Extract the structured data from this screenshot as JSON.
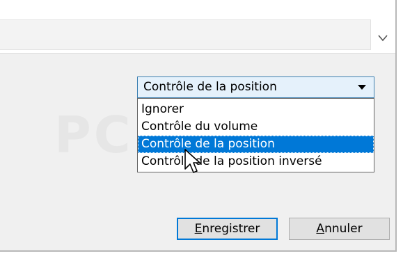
{
  "mode_select": {
    "selected": "Contrôle de la position",
    "options": [
      "Ignorer",
      "Contrôle du volume",
      "Contrôle de la position",
      "Contrôle de la position inversé"
    ],
    "selected_index": 2
  },
  "buttons": {
    "save": {
      "mnemonic": "E",
      "rest": "nregistrer"
    },
    "cancel": {
      "mnemonic": "A",
      "rest": "nnuler"
    }
  },
  "watermark_text": "PC",
  "icons": {
    "scroll_down": "chevron-down-icon",
    "combo_arrow": "triangle-down-icon",
    "cursor": "mouse-pointer-icon"
  },
  "colors": {
    "selection": "#0078d7",
    "combo_bg": "#e5f1fb",
    "combo_border": "#3c7fb1",
    "dialog_bg": "#f0f0f0"
  }
}
